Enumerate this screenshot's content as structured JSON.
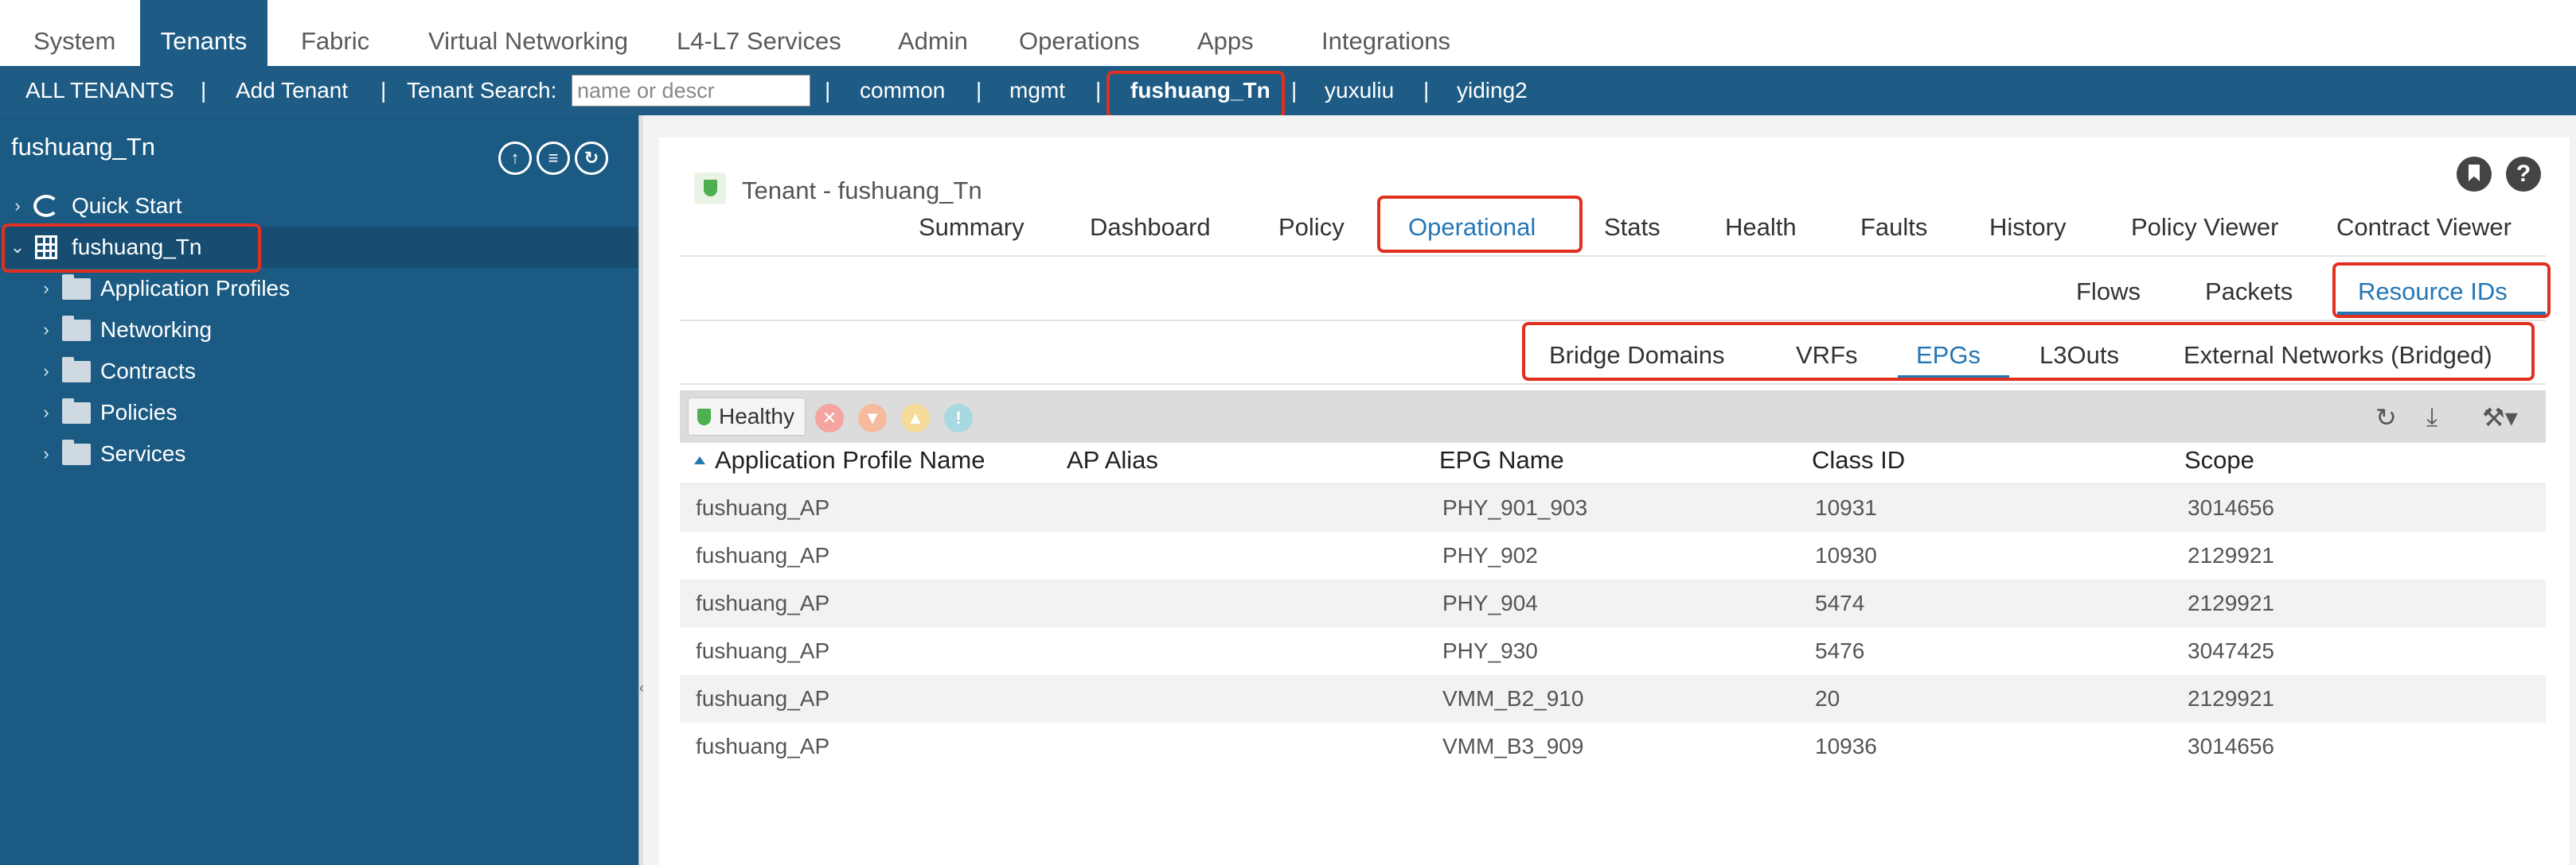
{
  "top_nav": [
    "System",
    "Tenants",
    "Fabric",
    "Virtual Networking",
    "L4-L7 Services",
    "Admin",
    "Operations",
    "Apps",
    "Integrations"
  ],
  "tenant_bar": {
    "all_tenants": "ALL TENANTS",
    "add_tenant": "Add Tenant",
    "search_label": "Tenant Search:",
    "search_placeholder": "name or descr",
    "separator": "|",
    "tenants": [
      "common",
      "mgmt",
      "fushuang_Tn",
      "yuxuliu",
      "yiding2"
    ]
  },
  "sidebar": {
    "title": "fushuang_Tn",
    "items": [
      "Quick Start",
      "fushuang_Tn",
      "Application Profiles",
      "Networking",
      "Contracts",
      "Policies",
      "Services"
    ]
  },
  "header": {
    "title": "Tenant - fushuang_Tn",
    "help": "?"
  },
  "tabs": [
    "Summary",
    "Dashboard",
    "Policy",
    "Operational",
    "Stats",
    "Health",
    "Faults",
    "History",
    "Policy Viewer",
    "Contract Viewer"
  ],
  "subtabs": [
    "Flows",
    "Packets",
    "Resource IDs"
  ],
  "resource_tabs": [
    "Bridge Domains",
    "VRFs",
    "EPGs",
    "L3Outs",
    "External Networks (Bridged)"
  ],
  "table": {
    "health": "Healthy",
    "columns": [
      "Application Profile Name",
      "AP Alias",
      "EPG Name",
      "Class ID",
      "Scope"
    ],
    "rows": [
      [
        "fushuang_AP",
        "",
        "PHY_901_903",
        "10931",
        "3014656"
      ],
      [
        "fushuang_AP",
        "",
        "PHY_902",
        "10930",
        "2129921"
      ],
      [
        "fushuang_AP",
        "",
        "PHY_904",
        "5474",
        "2129921"
      ],
      [
        "fushuang_AP",
        "",
        "PHY_930",
        "5476",
        "3047425"
      ],
      [
        "fushuang_AP",
        "",
        "VMM_B2_910",
        "20",
        "2129921"
      ],
      [
        "fushuang_AP",
        "",
        "VMM_B3_909",
        "10936",
        "3014656"
      ]
    ]
  },
  "colors": {
    "nav_blue": "#1e5c86",
    "sidebar_blue": "#1b5a83",
    "active_blue": "#2476b5",
    "highlight_red": "#e0311f"
  }
}
